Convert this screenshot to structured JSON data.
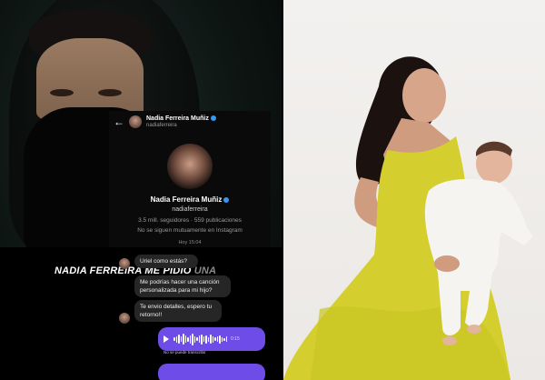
{
  "dm": {
    "header_name": "Nadia Ferreira Muñiz",
    "header_username": "nadiaferreira",
    "profile_name": "Nadia Ferreira Muñiz",
    "profile_username": "nadiaferreira",
    "stats": "3.5 mill. seguidores · 559 publicaciones",
    "mutual": "No se siguen mutuamente en Instagram",
    "time": "Hoy 15:04"
  },
  "overlay": {
    "banner_main": "NADIA FERREIRA ME PIDIÓ ",
    "banner_faded": "UNA"
  },
  "chat": {
    "messages": [
      "Uriel como estás?",
      "Me podrías hacer una canción personalizada para mi hijo?",
      "Te envio detalles, espero tu retorno!!"
    ],
    "voice_duration": "0:15",
    "voice_note": "No se puede transcribir"
  },
  "colors": {
    "voice_bubble": "#6d4ce8",
    "verified": "#3897f0",
    "dress": "#d8d33a"
  }
}
